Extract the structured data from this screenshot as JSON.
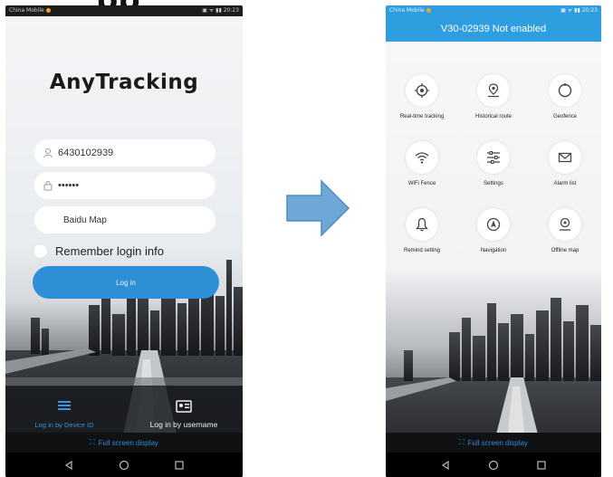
{
  "login_screen": {
    "status_bar": {
      "carrier": "China Mobile",
      "time": "20:23"
    },
    "logo": "AnyTracking",
    "username_value": "6430102939",
    "password_value": "••••••",
    "map_value": "Baidu Map",
    "remember_label": "Remember login info",
    "login_button": "Log in",
    "tabs": [
      {
        "label": "Log in by Device ID",
        "icon": "list-icon"
      },
      {
        "label": "Log in by username",
        "icon": "id-card-icon"
      }
    ],
    "fullscreen_label": "Full screen display",
    "colors": {
      "accent": "#2d8fd6",
      "active_tab": "#3a93dc"
    }
  },
  "menu_screen": {
    "status_bar": {
      "carrier": "China Mobile",
      "time": "20:23"
    },
    "header_title": "V30-02939 Not enabled",
    "items": [
      {
        "label": "Real-time tracking",
        "icon": "target-icon"
      },
      {
        "label": "Historical route",
        "icon": "map-pin-icon"
      },
      {
        "label": "Geofence",
        "icon": "circle-icon"
      },
      {
        "label": "WiFi Fence",
        "icon": "wifi-icon"
      },
      {
        "label": "Settings",
        "icon": "sliders-icon"
      },
      {
        "label": "Alarm list",
        "icon": "mail-icon"
      },
      {
        "label": "Remind setting",
        "icon": "bell-icon"
      },
      {
        "label": "Navigation",
        "icon": "navigation-icon"
      },
      {
        "label": "Offline map",
        "icon": "offline-map-icon"
      }
    ],
    "fullscreen_label": "Full screen display",
    "colors": {
      "header": "#2f9ee0"
    }
  },
  "arrow_color": "#6fa8d6"
}
